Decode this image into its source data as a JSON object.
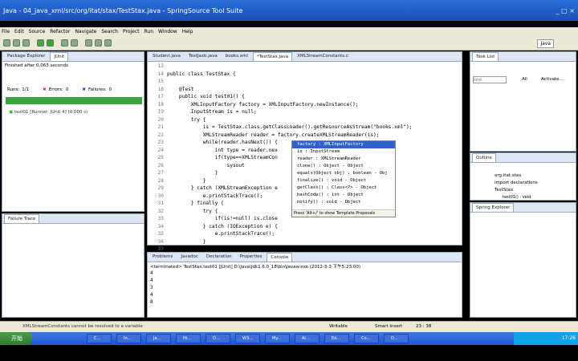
{
  "window": {
    "title": "Java - 04_java_xml/src/org/itat/stax/TestStax.java - SpringSource Tool Suite"
  },
  "menu": [
    "File",
    "Edit",
    "Source",
    "Refactor",
    "Navigate",
    "Search",
    "Project",
    "Run",
    "Window",
    "Help"
  ],
  "perspective_label": "Java",
  "left_panel": {
    "tabs": [
      "Package Explorer",
      "JUnit"
    ],
    "finished_text": "Finished after 0.063 seconds",
    "runs_label": "Runs:",
    "runs_value": "1/1",
    "errors_label": "Errors:",
    "errors_value": "0",
    "failures_label": "Failures:",
    "failures_value": "0",
    "progress_color": "#3aa53a",
    "test_item": "test01 [Runner: JUnit 4] (0.000 s)",
    "failure_trace_label": "Failure Trace"
  },
  "editor": {
    "tabs": [
      "Student.java",
      "TestJaxb.java",
      "books.xml",
      "*TestStax.java",
      "XMLStreamConstants.c"
    ],
    "active_tab_index": 3,
    "line_numbers": [
      "13",
      "14",
      "15",
      "16",
      "17",
      "18",
      "19",
      "20",
      "21",
      "22",
      "23",
      "24",
      "25",
      "26",
      "27",
      "28",
      "29",
      "30",
      "31",
      "32",
      "33",
      "34",
      "35",
      "36",
      "37"
    ],
    "lines": [
      "",
      "public class TestStax {",
      "",
      "    @Test",
      "    public void test01() {",
      "        XMLInputFactory factory = XMLInputFactory.newInstance();",
      "        InputStream is = null;",
      "        try {",
      "            is = TestStax.class.getClassLoader().getResourceAsStream(\"books.xml\");",
      "            XMLStreamReader reader = factory.createXMLStreamReader(is);",
      "            while(reader.hasNext()) {",
      "                int type = reader.nex",
      "                if(type==XMLStreamCon",
      "                    sysout",
      "                }",
      "            }",
      "        } catch (XMLStreamException e",
      "            e.printStackTrace();",
      "        } finally {",
      "            try {",
      "                if(is!=null) is.close",
      "            } catch (IOException e) {",
      "                e.printStackTrace();",
      "            }",
      "        }"
    ]
  },
  "content_assist": {
    "items": [
      "factory : XMLInputFactory",
      "is : InputStream",
      "reader : XMLStreamReader",
      "clone() : Object - Object",
      "equals(Object obj) : boolean - Obj",
      "finalize() : void - Object",
      "getClass() : Class<?> - Object",
      "hashCode() : int - Object",
      "notify() : void - Object"
    ],
    "hint": "Press 'Alt+/' to show Template Proposals"
  },
  "task_list": {
    "tab": "Task List",
    "find_placeholder": "Find",
    "all_label": "All",
    "activate_label": "Activate..."
  },
  "outline": {
    "tab": "Outline",
    "items": [
      "org.itat.stax",
      "import declarations",
      "TestStax",
      "test01() : void"
    ]
  },
  "spring_explorer": {
    "tab": "Spring Explorer"
  },
  "console": {
    "tabs": [
      "Problems",
      "Javadoc",
      "Declaration",
      "Properties",
      "Console"
    ],
    "active_tab_index": 4,
    "header": "<terminated> TestStax.test01 [JUnit] D:\\Java\\jdk1.6.0_18\\bin\\javaw.exe (2012-3-3 下午5:23:00)",
    "output": [
      "4",
      "4",
      "3",
      "4",
      "8"
    ]
  },
  "status": {
    "message": "XMLStreamConstants cannot be resolved to a variable",
    "writable": "Writable",
    "insert_mode": "Smart Insert",
    "position": "23 : 38"
  },
  "taskbar": {
    "start_label": "开始",
    "apps": [
      "C...",
      "In...",
      "Ja...",
      "Hi...",
      "D...",
      "W3...",
      "My...",
      "Al...",
      "Ed...",
      "Co...",
      "D..."
    ],
    "clock": "17:26"
  }
}
